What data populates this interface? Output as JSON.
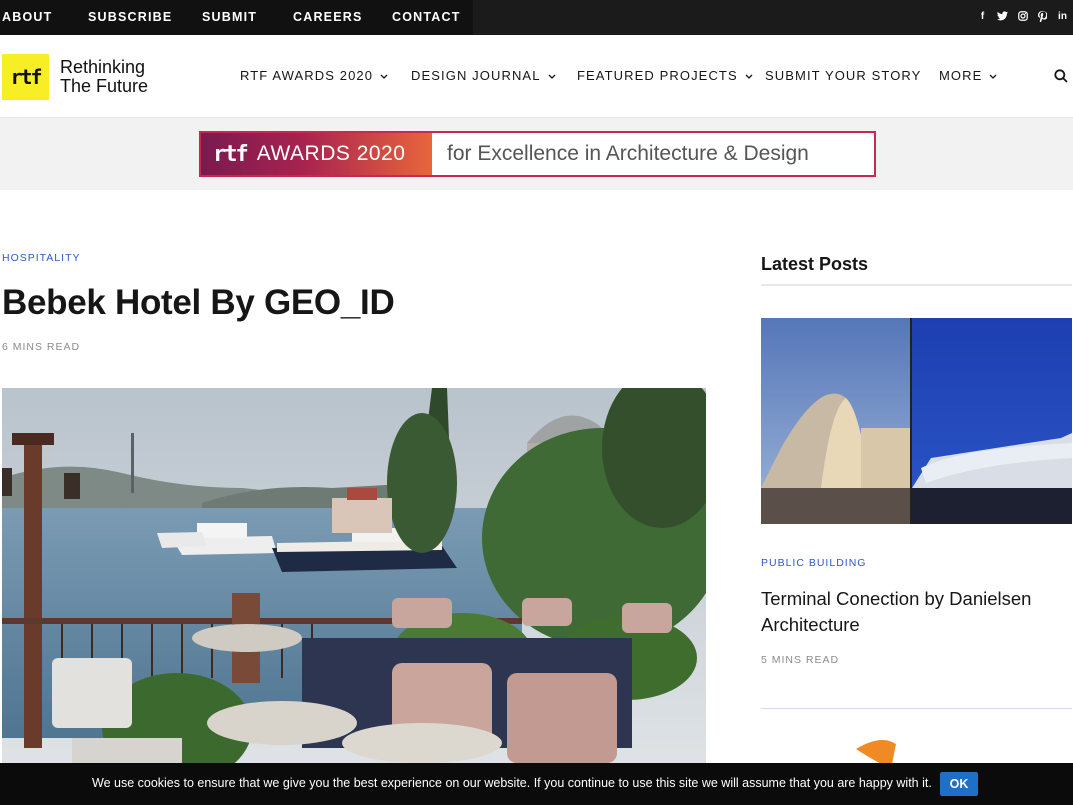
{
  "topbar": {
    "links": [
      "ABOUT",
      "SUBSCRIBE",
      "SUBMIT",
      "CAREERS",
      "CONTACT"
    ],
    "social": [
      "facebook-icon",
      "twitter-icon",
      "instagram-icon",
      "pinterest-icon",
      "linkedin-icon"
    ],
    "social_glyphs": [
      "f",
      "t",
      "◎",
      "p",
      "in"
    ]
  },
  "header": {
    "logo_mark": "rtf",
    "logo_line1": "Rethinking",
    "logo_line2": "The Future",
    "nav": [
      {
        "label": "RTF AWARDS 2020",
        "caret": "⌄"
      },
      {
        "label": "DESIGN JOURNAL",
        "caret": "⌄"
      },
      {
        "label": "FEATURED PROJECTS",
        "caret": "⌄"
      },
      {
        "label": "SUBMIT YOUR STORY",
        "caret": ""
      },
      {
        "label": "MORE",
        "caret": "⌄"
      }
    ]
  },
  "banner": {
    "logo": "rtf",
    "awards": "AWARDS 2020",
    "tagline": "for Excellence in Architecture & Design"
  },
  "article": {
    "category": "HOSPITALITY",
    "title": "Bebek Hotel By GEO_ID",
    "read_time": "6 MINS READ"
  },
  "sidebar": {
    "heading": "Latest Posts",
    "post": {
      "category": "PUBLIC BUILDING",
      "title": "Terminal Conection by Danielsen Architecture",
      "read_time": "5 MINS READ"
    }
  },
  "cookie": {
    "text": "We use cookies to ensure that we give you the best experience on our website. If you continue to use this site we will assume that you are happy with it.",
    "ok": "OK"
  },
  "colors": {
    "accent_blue": "#2d59c6",
    "logo_yellow": "#f7ee26",
    "banner_border": "#c8294f",
    "cookie_button": "#1f6fc9"
  }
}
